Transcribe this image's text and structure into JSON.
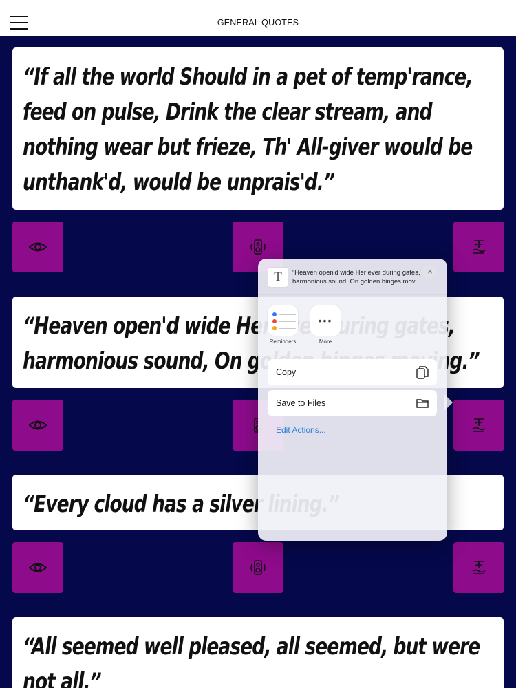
{
  "header": {
    "title": "GENERAL QUOTES",
    "menu_icon": "hamburger-menu-icon"
  },
  "quotes": [
    {
      "text": "“If all the world Should in a pet of temp'rance, feed on pulse, Drink the clear stream, and nothing wear but frieze, Th' All-giver would be unthank'd, would be unprais'd.”"
    },
    {
      "text": "“Heaven open'd wide Her ever during gates, harmonious sound, On golden hinges moving.”"
    },
    {
      "text": "“Every cloud has a silver lining.”"
    },
    {
      "text": "“All seemed well pleased, all seemed, but were not all.”"
    }
  ],
  "tile_icons": [
    "eye-icon",
    "speaker-icon",
    "hand-icon"
  ],
  "colors": {
    "background": "#05084a",
    "tile": "#8e0b8c",
    "link": "#2b7fd8"
  },
  "share_sheet": {
    "preview_line1": "“Heaven open'd wide Her ever during gates,",
    "preview_line2": "harmonious sound, On golden hinges movi...",
    "close_label": "×",
    "apps": [
      {
        "label": "Reminders",
        "icon": "reminders-icon"
      },
      {
        "label": "More",
        "icon": "more-icon"
      }
    ],
    "more_glyph": "•••",
    "actions": [
      {
        "label": "Copy",
        "icon": "copy-icon"
      },
      {
        "label": "Save to Files",
        "icon": "folder-icon"
      }
    ],
    "edit_actions_label": "Edit Actions..."
  }
}
